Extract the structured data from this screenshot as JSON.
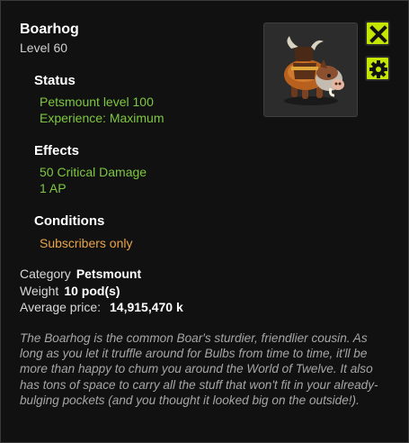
{
  "item": {
    "name": "Boarhog",
    "level_label": "Level",
    "level_value": "60",
    "image_icon": "boarhog-mount-icon"
  },
  "buttons": {
    "close_icon": "close-icon",
    "settings_icon": "gear-icon"
  },
  "status": {
    "heading": "Status",
    "lines": [
      "Petsmount level 100",
      "Experience: Maximum"
    ]
  },
  "effects": {
    "heading": "Effects",
    "lines": [
      {
        "value": "50",
        "text": "Critical Damage"
      },
      {
        "value": "1",
        "text": "AP"
      }
    ]
  },
  "conditions": {
    "heading": "Conditions",
    "lines": [
      "Subscribers only"
    ]
  },
  "properties": {
    "category_label": "Category",
    "category_value": "Petsmount",
    "weight_label": "Weight",
    "weight_value": "10 pod(s)",
    "price_label": "Average price:",
    "price_value": "14,915,470 k"
  },
  "description": "The Boarhog is the common Boar's sturdier, friendlier cousin. As long as you let it truffle around for Bulbs from time to time, it'll be more than happy to chum you around the World of Twelve. It also has tons of space to carry all the stuff that won't fit in your already-bulging pockets (and you thought it looked big on the outside!).",
  "colors": {
    "panel_bg": "#111111",
    "accent_button": "#c5e600",
    "effect_green": "#7ec840",
    "condition_orange": "#e9a448",
    "description_grey": "#a6a6a6"
  }
}
